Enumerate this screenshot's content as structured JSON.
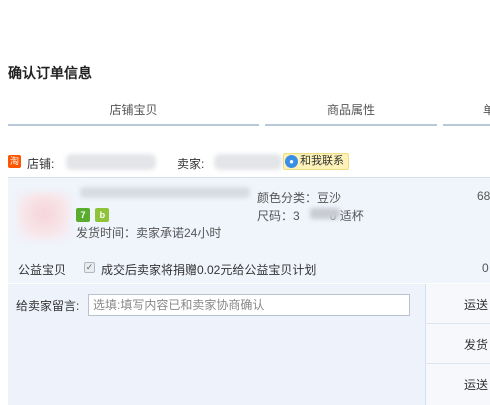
{
  "page": {
    "title": "确认订单信息"
  },
  "columns": {
    "shop_item": "店铺宝贝",
    "attributes": "商品属性",
    "price": "单"
  },
  "shop": {
    "label": "店铺:",
    "seller_label": "卖家:",
    "contact_label": "和我联系",
    "icon": "taobao-icon"
  },
  "item": {
    "badges": [
      "7",
      "b"
    ],
    "ship_time": "发货时间：卖家承诺24小时",
    "attr_color": "颜色分类：豆沙",
    "attr_size_prefix": "尺码：3",
    "attr_size_suffix": "0 适杯",
    "price": "68"
  },
  "charity": {
    "label": "公益宝贝",
    "checked": true,
    "text": "成交后卖家将捐赠0.02元给公益宝贝计划",
    "value": "0"
  },
  "message": {
    "label": "给卖家留言:",
    "placeholder": "选填:填写内容已和卖家协商确认"
  },
  "right_panel": {
    "shipping": "运送",
    "invoice": "发货",
    "extra": "运送"
  },
  "colors": {
    "accent_underline": "#b8c8d8",
    "item_bg": "#f0f4fb",
    "contact_bg": "#fdf3b8",
    "taobao_orange": "#ff5500"
  }
}
